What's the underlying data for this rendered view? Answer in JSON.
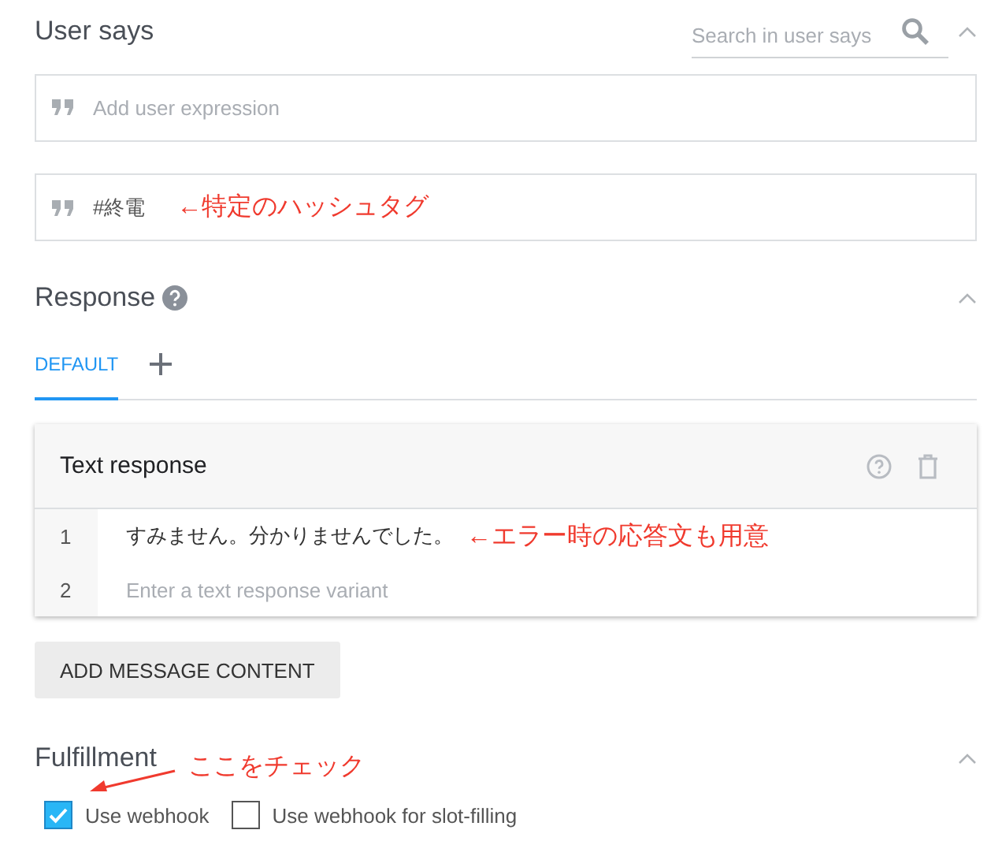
{
  "user_says": {
    "title": "User says",
    "search": {
      "placeholder": "Search in user says"
    },
    "expressions": [
      {
        "placeholder": "Add user expression"
      },
      {
        "value": "#終電",
        "annotation": "←特定のハッシュタグ"
      }
    ]
  },
  "response": {
    "title": "Response",
    "tabs": [
      {
        "label": "DEFAULT",
        "selected": true
      }
    ],
    "card": {
      "title": "Text response",
      "rows": [
        {
          "number": "1",
          "value": "すみません。分かりませんでした。",
          "annotation": "←エラー時の応答文も用意"
        },
        {
          "number": "2",
          "placeholder": "Enter a text response variant"
        }
      ]
    },
    "add_button": "ADD MESSAGE CONTENT"
  },
  "fulfillment": {
    "title": "Fulfillment",
    "annotation": "ここをチェック",
    "checkboxes": [
      {
        "label": "Use webhook",
        "checked": true
      },
      {
        "label": "Use webhook for slot-filling",
        "checked": false
      }
    ]
  }
}
